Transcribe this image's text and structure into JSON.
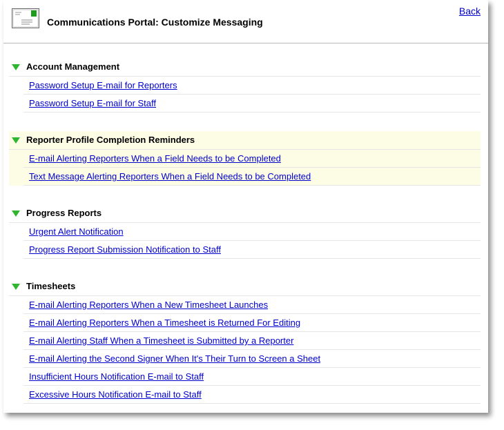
{
  "header": {
    "title": "Communications Portal: Customize Messaging",
    "back_label": "Back",
    "icon": "envelope-icon"
  },
  "colors": {
    "link": "#0000cc",
    "triangle": "#2fb52f",
    "highlight": "#fdfde6"
  },
  "sections": [
    {
      "title": "Account Management",
      "links": [
        "Password Setup E-mail for Reporters",
        "Password Setup E-mail for Staff"
      ]
    },
    {
      "title": "Reporter Profile Completion Reminders",
      "links": [
        "E-mail Alerting Reporters When a Field Needs to be Completed",
        "Text Message Alerting Reporters When a Field Needs to be Completed"
      ]
    },
    {
      "title": "Progress Reports",
      "links": [
        "Urgent Alert Notification",
        "Progress Report Submission Notification to Staff"
      ]
    },
    {
      "title": "Timesheets",
      "links": [
        "E-mail Alerting Reporters When a New Timesheet Launches",
        "E-mail Alerting Reporters When a Timesheet is Returned For Editing",
        "E-mail Alerting Staff When a Timesheet is Submitted by a Reporter",
        "E-mail Alerting the Second Signer When It's Their Turn to Screen a Sheet",
        "Insufficient Hours Notification E-mail to Staff",
        "Excessive Hours Notification E-mail to Staff"
      ]
    }
  ]
}
